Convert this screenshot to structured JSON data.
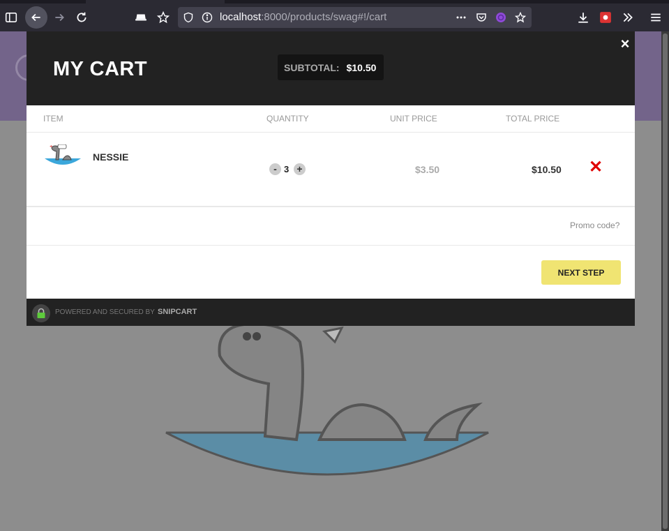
{
  "browser": {
    "url_host": "localhost",
    "url_rest": ":8000/products/swag#!/cart",
    "icons": [
      "sidebar-icon",
      "back-icon",
      "forward-icon",
      "reload-icon",
      "pocket-list-icon",
      "bookmark-star-icon",
      "shield-icon",
      "info-icon",
      "more-icon",
      "pocket-icon",
      "extension-icon",
      "star-icon",
      "download-icon",
      "addon-icon",
      "overflow-icon",
      "menu-icon"
    ]
  },
  "cart": {
    "title": "MY CART",
    "subtotal_label": "SUBTOTAL:",
    "subtotal_value": "$10.50",
    "close_label": "×",
    "columns": {
      "item": "ITEM",
      "quantity": "QUANTITY",
      "unit_price": "UNIT PRICE",
      "total_price": "TOTAL PRICE"
    },
    "items": [
      {
        "name": "NESSIE",
        "quantity": "3",
        "unit_price": "$3.50",
        "total_price": "$10.50",
        "decrement_label": "-",
        "increment_label": "+",
        "remove_label": "✕"
      }
    ],
    "promo_label": "Promo code?",
    "next_label": "NEXT STEP",
    "footer_text": "POWERED AND SECURED BY",
    "footer_brand": "SNIPCART"
  },
  "colors": {
    "modal_header": "#222222",
    "next_button": "#f0e472",
    "remove": "#e00000",
    "page_header": "#73648a"
  }
}
